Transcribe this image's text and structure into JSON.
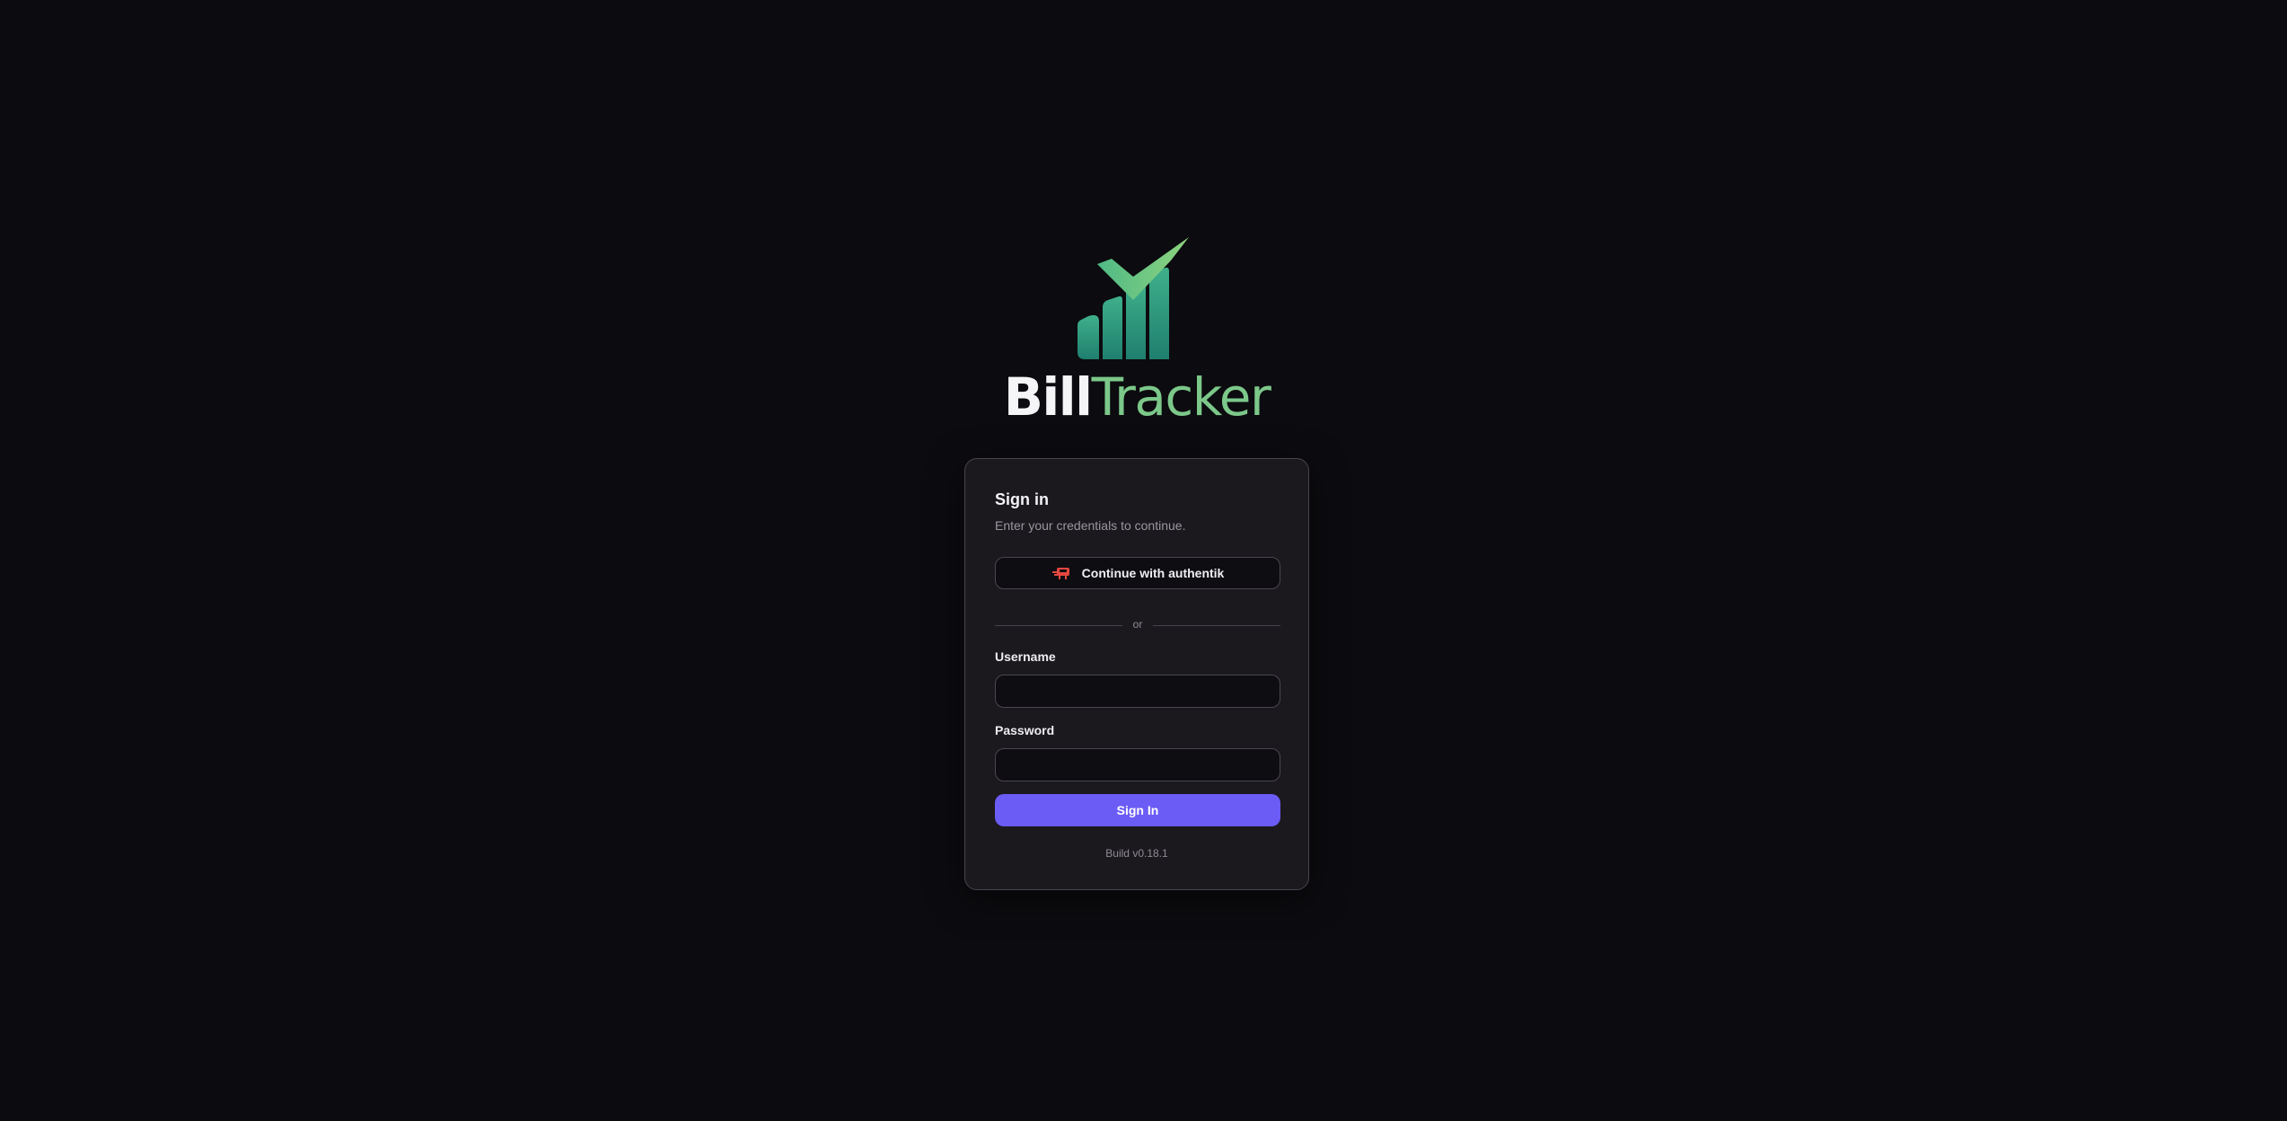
{
  "brand": {
    "name_part1": "Bill",
    "name_part2": "Tracker",
    "logo_icon": "bar-chart-check-icon",
    "accent_green": "#7cc88a"
  },
  "login_card": {
    "title": "Sign in",
    "subtitle": "Enter your credentials to continue.",
    "sso_button": {
      "label": "Continue with authentik",
      "icon": "authentik-icon"
    },
    "divider_text": "or",
    "username": {
      "label": "Username",
      "value": ""
    },
    "password": {
      "label": "Password",
      "value": ""
    },
    "submit_label": "Sign In",
    "build": "Build v0.18.1"
  },
  "colors": {
    "background": "#0c0b0f",
    "card": "#1c191e",
    "primary": "#6b5cf6",
    "sso_icon": "#e4473f"
  }
}
